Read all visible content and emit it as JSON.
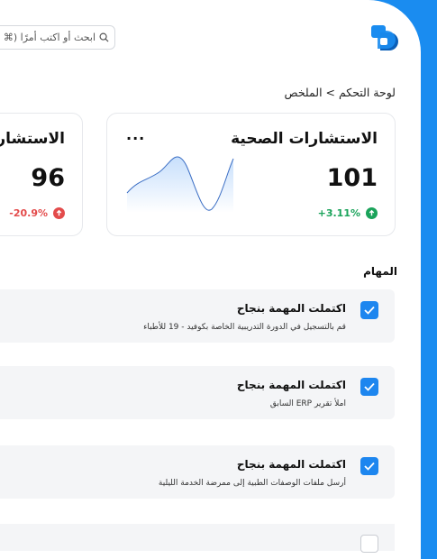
{
  "colors": {
    "accent": "#1a8cf0",
    "success": "#1aa35a",
    "danger": "#e34b4b",
    "task_bg": "#f4f5f7"
  },
  "search": {
    "placeholder": "ابحث أو اكتب أمرًا (⌘"
  },
  "breadcrumb": "لوحة التحكم > الملخص",
  "cards": [
    {
      "title": "الاستشارات الصحية",
      "value": "101",
      "change": "+3.11%",
      "trend": "up",
      "menu": "..."
    },
    {
      "title": "الاستشارات",
      "value": "96",
      "change": "-20.9%",
      "trend": "down"
    }
  ],
  "tasks_section": {
    "title": "المهام"
  },
  "tasks": [
    {
      "title": "اكتملت المهمة بنجاح",
      "desc": "قم بالتسجيل في الدورة التدريبية الخاصة بكوفيد - 19 للأطباء",
      "checked": true
    },
    {
      "title": "اكتملت المهمة بنجاح",
      "desc": "املأ تقرير ERP السابق",
      "checked": true
    },
    {
      "title": "اكتملت المهمة بنجاح",
      "desc": "أرسل ملفات الوصفات الطبية إلى ممرضة الخدمة الليلية",
      "checked": true
    }
  ]
}
